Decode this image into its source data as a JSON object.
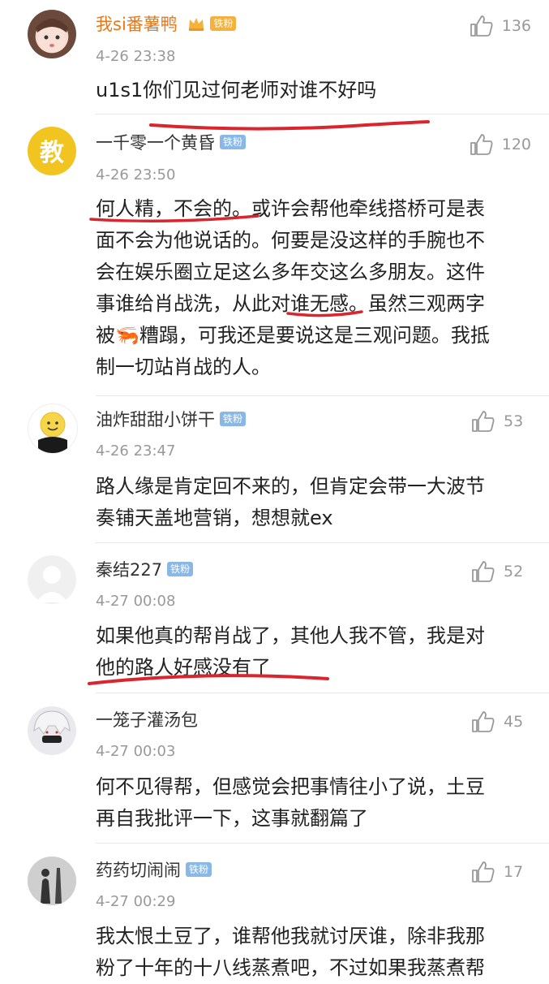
{
  "comments": [
    {
      "username": "我si番薯鸭",
      "badge": "铁粉",
      "time": "4-26 23:38",
      "likes": "136",
      "text": "u1s1你们见过何老师对谁不好吗"
    },
    {
      "username": "一千零一个黄昏",
      "badge": "铁粉",
      "avatar_text": "教",
      "time": "4-26 23:50",
      "likes": "120",
      "lines": [
        "何人精，不会的。或许会帮他牵线搭桥可是表",
        "面不会为他说话的。何要是没这样的手腕也不",
        "会在娱乐圈立足这么多年交这么多朋友。这件",
        "事谁给肖战洗，从此对谁无感。虽然三观两字",
        "被🦐糟蹋，可我还是要说这是三观问题。我抵",
        "制一切站肖战的人。"
      ]
    },
    {
      "username": "油炸甜甜小饼干",
      "badge": "铁粉",
      "time": "4-26 23:47",
      "likes": "53",
      "lines": [
        "路人缘是肯定回不来的，但肯定会带一大波节",
        "奏铺天盖地营销，想想就ex"
      ]
    },
    {
      "username": "秦结227",
      "badge": "铁粉",
      "time": "4-27 00:08",
      "likes": "52",
      "lines": [
        "如果他真的帮肖战了，其他人我不管，我是对",
        "他的路人好感没有了"
      ]
    },
    {
      "username": "一笼子灌汤包",
      "time": "4-27 00:03",
      "likes": "45",
      "lines": [
        "何不见得帮，但感觉会把事情往小了说，土豆",
        "再自我批评一下，这事就翻篇了"
      ]
    },
    {
      "username": "药药切闹闹",
      "badge": "铁粉",
      "time": "4-27 00:29",
      "likes": "17",
      "lines": [
        "我太恨土豆了，谁帮他我就讨厌谁，除非我那",
        "粉了十年的十八线蒸煮吧，不过如果我蒸煮帮"
      ]
    }
  ],
  "colors": {
    "vip_name": "#e8781a",
    "badge": "#8ab8e6",
    "badge_gold": "#f5b13d",
    "underline": "#d9262e"
  }
}
